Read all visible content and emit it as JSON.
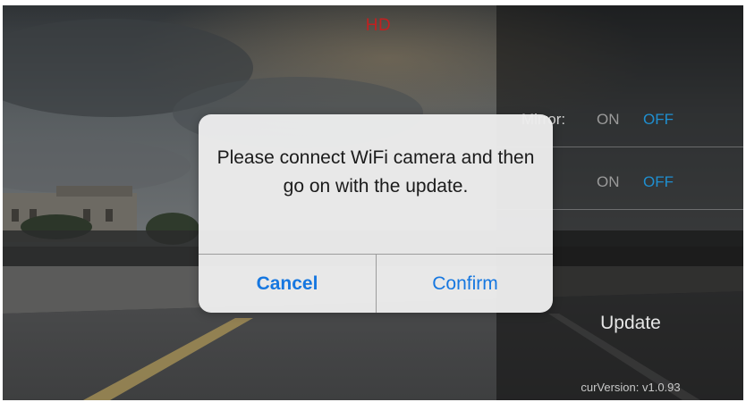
{
  "overlay": {
    "quality_label": "HD"
  },
  "settings": {
    "rows": [
      {
        "name": "Mirror:",
        "on_label": "ON",
        "off_label": "OFF"
      },
      {
        "name": "",
        "on_label": "ON",
        "off_label": "OFF"
      }
    ],
    "update_label": "Update",
    "version_text": "curVersion: v1.0.93"
  },
  "dialog": {
    "message": "Please connect WiFi camera and then go on with the update.",
    "cancel_label": "Cancel",
    "confirm_label": "Confirm"
  },
  "colors": {
    "accent": "#1677e0",
    "off_active": "#1f8fd0",
    "hd_red": "#c22020"
  }
}
